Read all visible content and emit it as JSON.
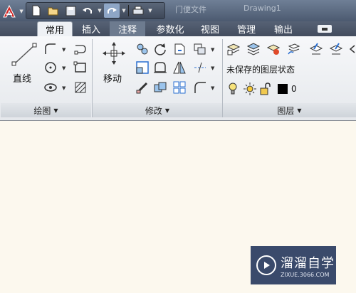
{
  "quick_access": {
    "title_text_1": "门便文件",
    "title_text_2": "Drawing1"
  },
  "tabs": [
    {
      "label": "常用",
      "state": "active"
    },
    {
      "label": "插入",
      "state": "normal"
    },
    {
      "label": "注释",
      "state": "highlight"
    },
    {
      "label": "参数化",
      "state": "normal"
    },
    {
      "label": "视图",
      "state": "normal"
    },
    {
      "label": "管理",
      "state": "normal"
    },
    {
      "label": "输出",
      "state": "normal"
    }
  ],
  "panels": {
    "draw": {
      "title": "绘图",
      "line_label": "直线"
    },
    "modify": {
      "title": "修改",
      "move_label": "移动"
    },
    "layers": {
      "title": "图层",
      "layer_state": "未保存的图层状态",
      "current_layer": "0"
    }
  },
  "watermark": {
    "title": "溜溜自学",
    "url": "ZIXUE.3066.COM"
  },
  "colors": {
    "accent": "#4c5a70",
    "ribbon_bg": "#eef1f5",
    "canvas": "#fcf8ee",
    "watermark_bg": "#3a4a6b"
  }
}
